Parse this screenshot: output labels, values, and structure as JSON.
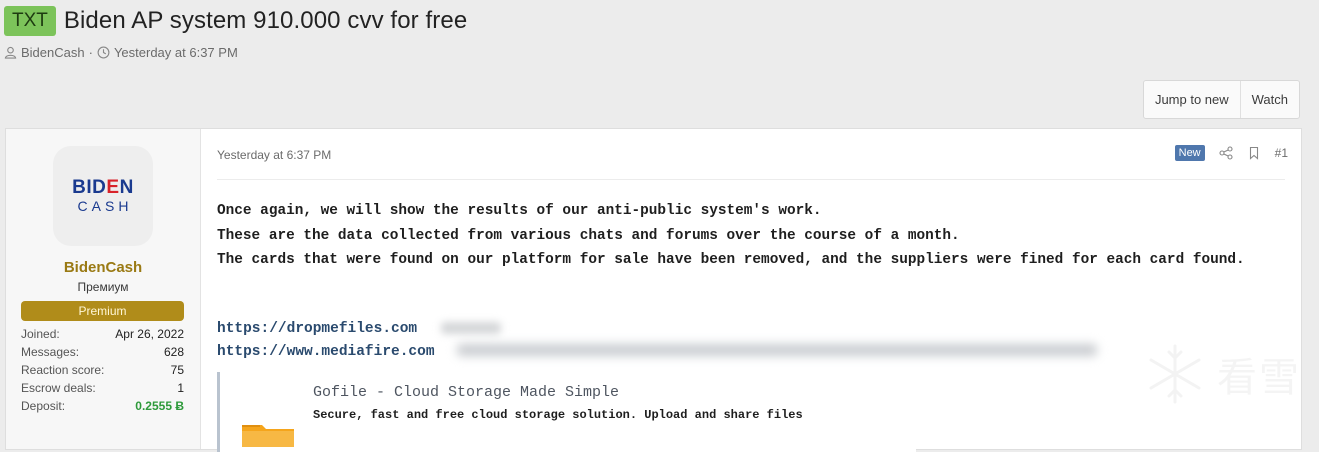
{
  "thread": {
    "prefix": "TXT",
    "title": "Biden AP system 910.000 cvv for free",
    "author": "BidenCash",
    "date": "Yesterday at 6:37 PM"
  },
  "actions": {
    "jump_to_new": "Jump to new",
    "watch": "Watch"
  },
  "user": {
    "avatar_line1_a": "BID",
    "avatar_line1_b": "E",
    "avatar_line1_c": "N",
    "avatar_line2": "CASH",
    "name": "BidenCash",
    "title": "Премиум",
    "banner": "Premium",
    "stats": [
      {
        "key": "Joined:",
        "value": "Apr 26, 2022"
      },
      {
        "key": "Messages:",
        "value": "628"
      },
      {
        "key": "Reaction score:",
        "value": "75"
      },
      {
        "key": "Escrow deals:",
        "value": "1"
      },
      {
        "key": "Deposit:",
        "value": "0.2555 Ƀ"
      }
    ]
  },
  "post": {
    "date": "Yesterday at 6:37 PM",
    "new_badge": "New",
    "number": "#1",
    "lines": [
      "Once again, we will show the results of our anti-public system's work.",
      "These are the data collected from various chats and forums over the course of a month.",
      "The cards that were found on our platform for sale have been removed, and the suppliers were fined for each card found."
    ],
    "links": [
      "https://dropmefiles.com",
      "https://www.mediafire.com"
    ],
    "embed": {
      "title": "Gofile - Cloud Storage Made Simple",
      "description": "Secure, fast and free cloud storage solution. Upload and share files"
    }
  },
  "watermark": {
    "text": "看雪"
  },
  "colors": {
    "prefix_bg": "#7cc35a",
    "username": "#9a7a14",
    "banner_bg": "#b08c1a",
    "new_badge": "#4f77ad",
    "deposit": "#2e9a3a"
  }
}
